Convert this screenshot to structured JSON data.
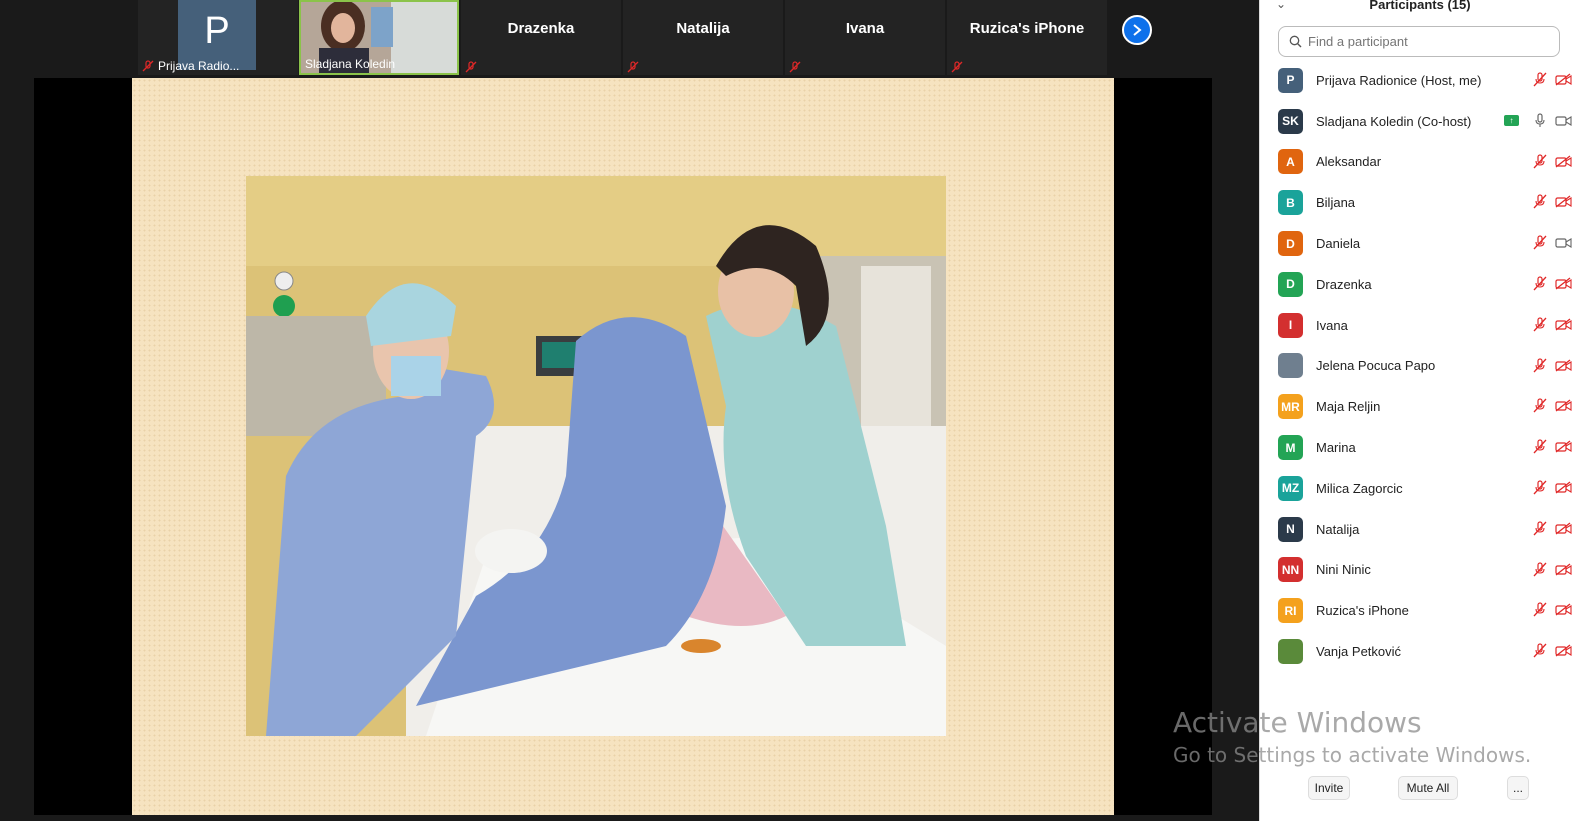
{
  "strip": {
    "tiles": [
      {
        "name": "Prijava Radio...",
        "initial": "P",
        "avatar_color": "#45607a"
      },
      {
        "name": "Sladjana Koledin"
      },
      {
        "name": "Drazenka"
      },
      {
        "name": "Natalija"
      },
      {
        "name": "Ivana"
      },
      {
        "name": "Ruzica's iPhone"
      }
    ]
  },
  "panel": {
    "title": "Participants (15)",
    "search_placeholder": "Find a participant",
    "participants": [
      {
        "initials": "P",
        "name": "Prijava Radionice (Host, me)",
        "color": "#45607a"
      },
      {
        "initials": "SK",
        "name": "Sladjana Koledin (Co-host)",
        "color": "#2b3a4a"
      },
      {
        "initials": "A",
        "name": "Aleksandar",
        "color": "#e0650f"
      },
      {
        "initials": "B",
        "name": "Biljana",
        "color": "#1aa39a"
      },
      {
        "initials": "D",
        "name": "Daniela",
        "color": "#e0650f"
      },
      {
        "initials": "D",
        "name": "Drazenka",
        "color": "#23a455"
      },
      {
        "initials": "I",
        "name": "Ivana",
        "color": "#d32f2f"
      },
      {
        "initials": "",
        "name": "Jelena Pocuca Papo",
        "color": "#6f7f8f"
      },
      {
        "initials": "MR",
        "name": "Maja Reljin",
        "color": "#f4a11d"
      },
      {
        "initials": "M",
        "name": "Marina",
        "color": "#23a455"
      },
      {
        "initials": "MZ",
        "name": "Milica Zagorcic",
        "color": "#1aa39a"
      },
      {
        "initials": "N",
        "name": "Natalija",
        "color": "#2b3a4a"
      },
      {
        "initials": "NN",
        "name": "Nini Ninic",
        "color": "#d32f2f"
      },
      {
        "initials": "RI",
        "name": "Ruzica's iPhone",
        "color": "#f4a11d"
      },
      {
        "initials": "",
        "name": "Vanja Petković",
        "color": "#5a8a3a"
      }
    ],
    "invite_label": "Invite",
    "mute_all_label": "Mute All",
    "more_label": "..."
  },
  "watermark": {
    "title": "Activate Windows",
    "subtitle": "Go to Settings to activate Windows."
  },
  "colors": {
    "muted_red": "#e02828",
    "accent_blue": "#0e71eb",
    "slide_bg": "#f6e3c0"
  }
}
